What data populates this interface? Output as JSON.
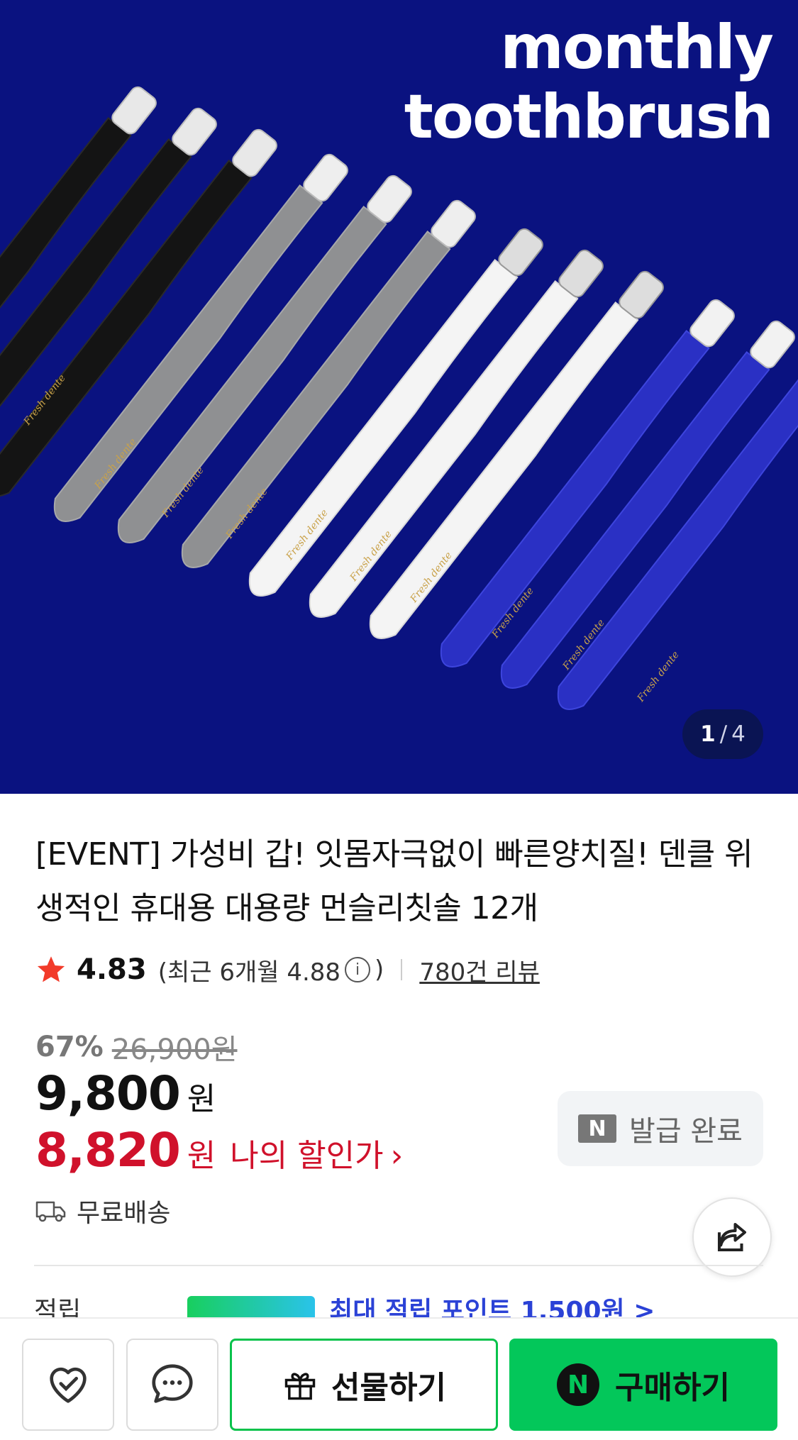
{
  "hero": {
    "title_line1": "monthly",
    "title_line2": "toothbrush",
    "brush_print": "Fresh dente",
    "counter": {
      "current": "1",
      "separator": "/",
      "total": "4"
    }
  },
  "product": {
    "title": "[EVENT] 가성비 갑! 잇몸자극없이 빠른양치질! 덴클 위생적인 휴대용 대용량 먼슬리칫솔 12개",
    "rating": "4.83",
    "recent_prefix": "(최근 6개월 4.88",
    "recent_suffix": ")",
    "reviews": "780건 리뷰",
    "discount_rate": "67%",
    "original_price": "26,900원",
    "price": "9,800",
    "price_unit": "원",
    "my_price": "8,820",
    "my_price_unit": "원",
    "my_price_label": "나의 할인가",
    "coupon_badge": "N",
    "coupon_label": "발급 완료",
    "shipping": "무료배송"
  },
  "peek": {
    "label": "적립",
    "link": "최대 적립 포인트 1,500원 >"
  },
  "bottom_bar": {
    "gift_label": "선물하기",
    "buy_badge": "N",
    "buy_label": "구매하기"
  },
  "colors": {
    "hero_bg": "#0a1280",
    "accent_red": "#d0112b",
    "naver_green": "#03c75a",
    "star": "#f23b2a",
    "link_blue": "#2b42d6"
  },
  "icons": {
    "rating": "star-icon",
    "shipping": "truck-icon",
    "share": "share-icon",
    "wishlist": "heart-check-icon",
    "chat": "chat-bubble-icon",
    "gift": "gift-box-icon"
  }
}
